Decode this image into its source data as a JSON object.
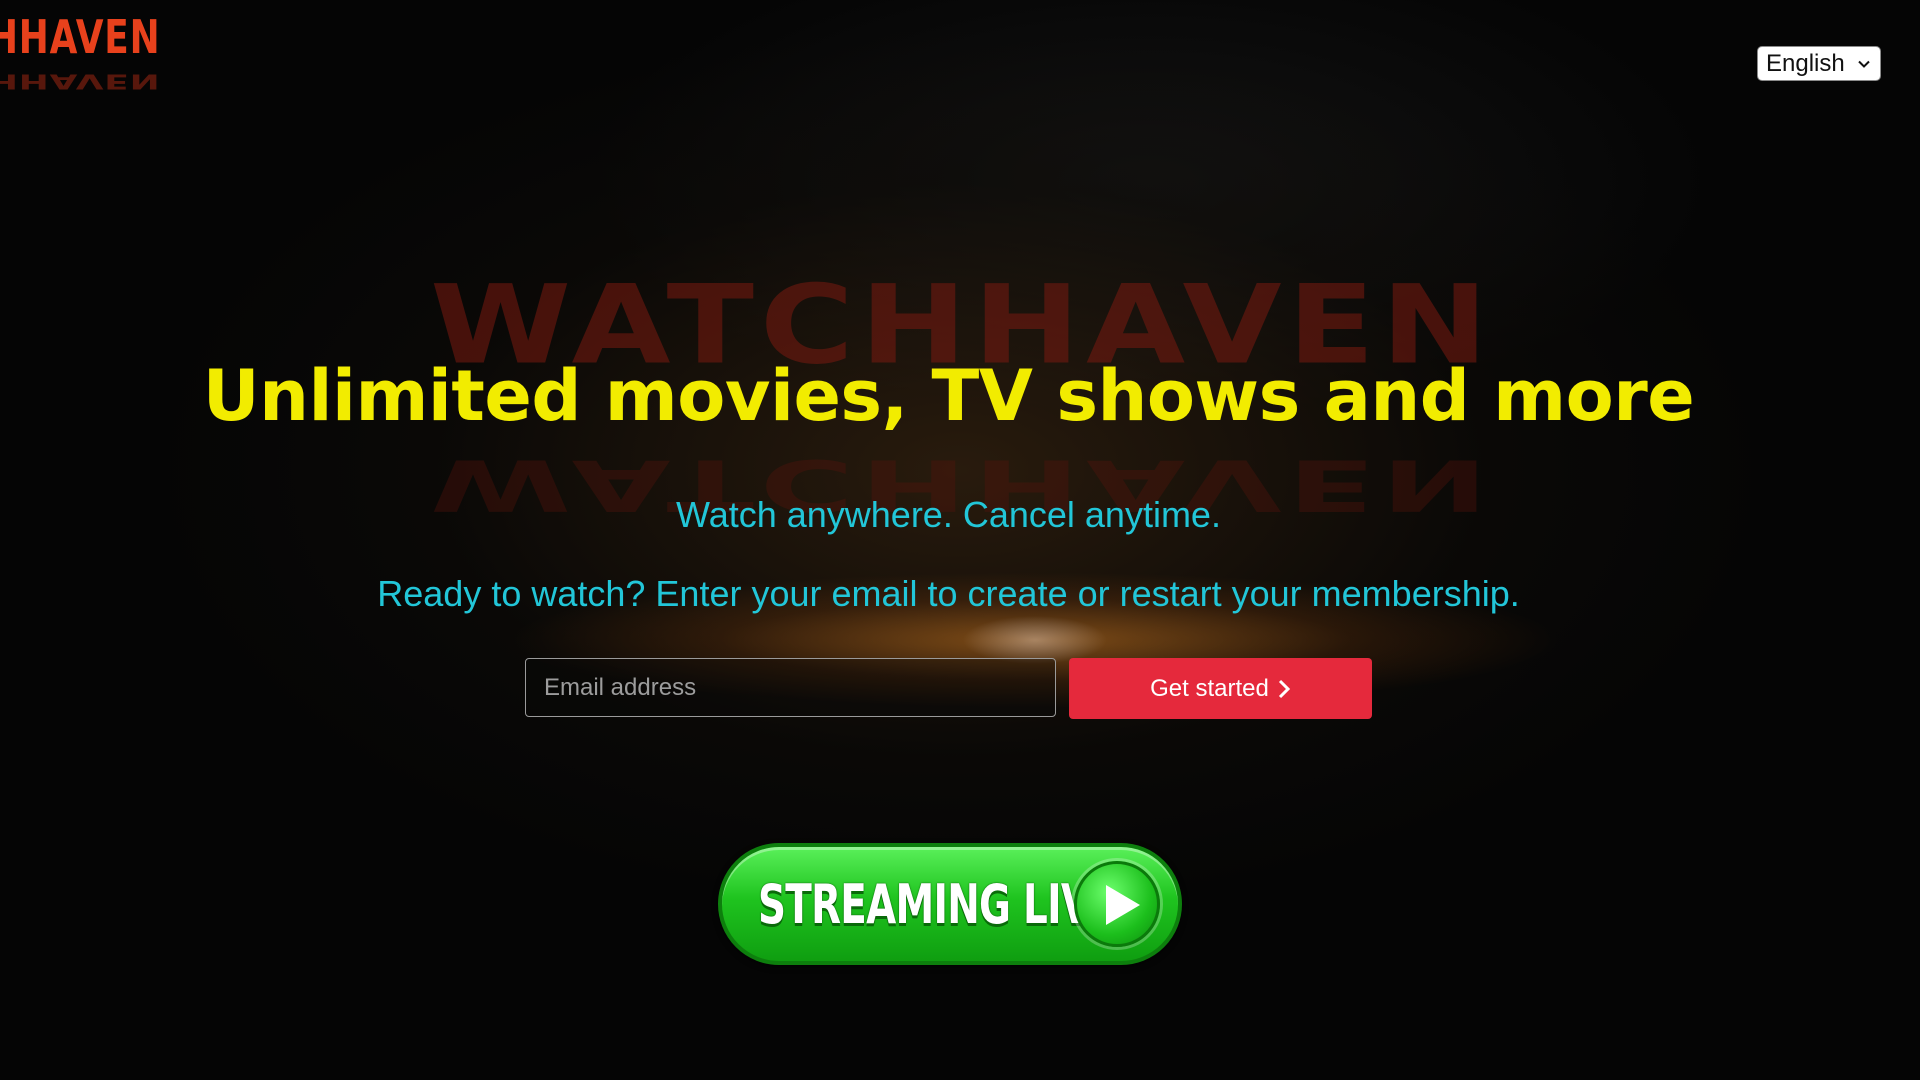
{
  "brand": {
    "logo_text": "HHAVEN",
    "background_wordmark": "WATCHHAVEN"
  },
  "header": {
    "language": {
      "selected": "English",
      "options": [
        "English"
      ]
    }
  },
  "hero": {
    "headline": "Unlimited movies, TV shows and more",
    "subtitle": "Watch anywhere. Cancel anytime.",
    "prompt": "Ready to watch? Enter your email to create or restart your membership.",
    "email_placeholder": "Email address",
    "cta_label": "Get started"
  },
  "streaming_banner": {
    "label": "STREAMING LIVE",
    "icon": "play-icon"
  },
  "colors": {
    "headline": "#f2ec00",
    "subtext": "#22c6d8",
    "cta": "#e5293c",
    "logo": "#e8411c",
    "stream_green": "#1fc41f"
  }
}
